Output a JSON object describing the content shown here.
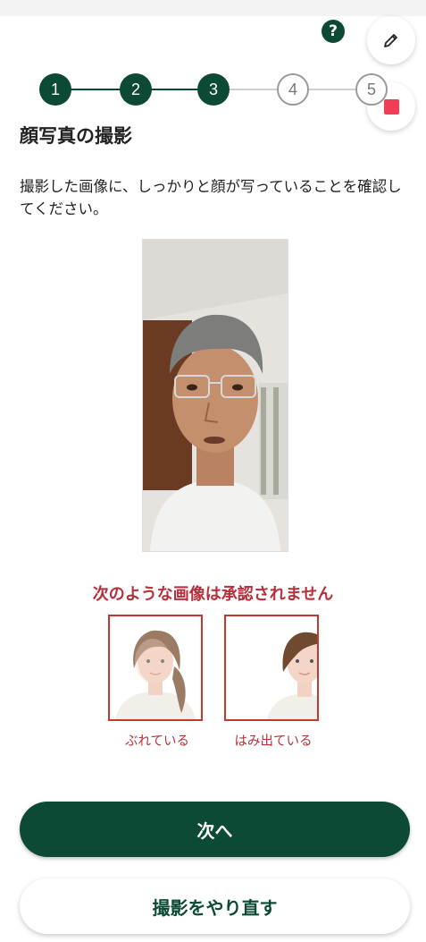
{
  "header": {
    "help_label": "?"
  },
  "stepper": {
    "steps": [
      {
        "label": "1",
        "state": "done"
      },
      {
        "label": "2",
        "state": "done"
      },
      {
        "label": "3",
        "state": "current"
      },
      {
        "label": "4",
        "state": "todo"
      },
      {
        "label": "5",
        "state": "todo"
      }
    ]
  },
  "page": {
    "title": "顔写真の撮影",
    "description": "撮影した画像に、しっかりと顔が写っていることを確認してください。"
  },
  "rejection": {
    "title": "次のような画像は承認されません",
    "examples": [
      {
        "label": "ぶれている"
      },
      {
        "label": "はみ出ている"
      }
    ]
  },
  "buttons": {
    "next": "次へ",
    "retake": "撮影をやり直す"
  },
  "colors": {
    "brand": "#0d4a36",
    "alert": "#b5303a",
    "record": "#ef3e55"
  },
  "icons": [
    "help-icon",
    "pencil-icon",
    "stop-icon"
  ]
}
